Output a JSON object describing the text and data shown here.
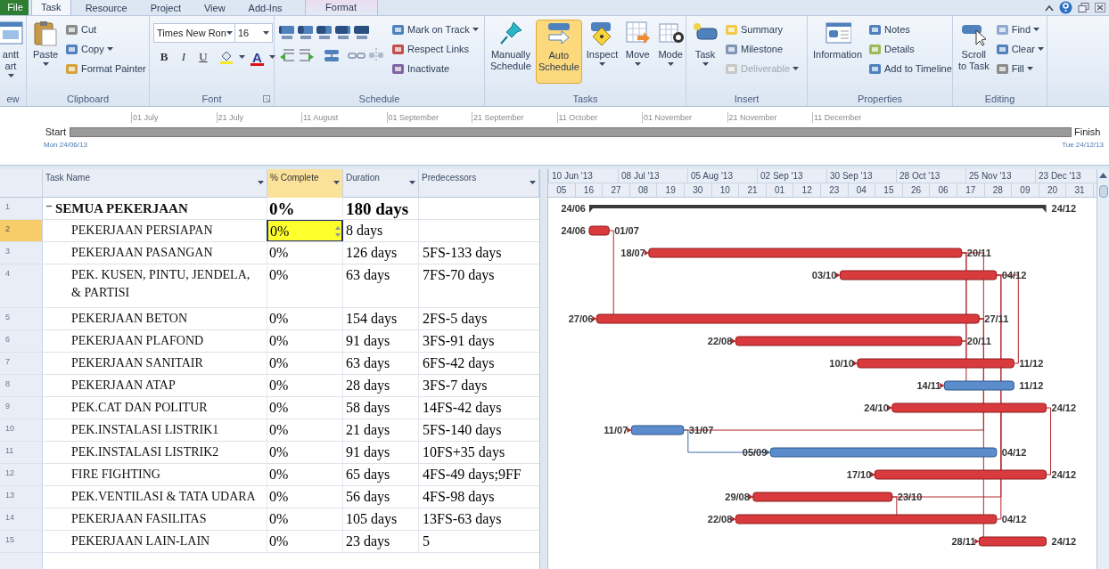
{
  "ribbon": {
    "tabs": [
      {
        "label": "File",
        "kind": "file",
        "selected": false
      },
      {
        "label": "Task",
        "kind": "tab",
        "selected": true
      },
      {
        "label": "Resource",
        "kind": "tab",
        "selected": false
      },
      {
        "label": "Project",
        "kind": "tab",
        "selected": false
      },
      {
        "label": "View",
        "kind": "tab",
        "selected": false
      },
      {
        "label": "Add-Ins",
        "kind": "tab",
        "selected": false
      },
      {
        "label": "Format",
        "kind": "contextual",
        "selected": false
      }
    ],
    "groups": [
      {
        "kind": "standard",
        "label": "ew",
        "items": [
          {
            "kind": "large",
            "lines": [
              "antt",
              "art"
            ],
            "dropdown": true
          }
        ]
      },
      {
        "kind": "standard",
        "label": "Clipboard",
        "items": [
          {
            "kind": "large",
            "lines": [
              "Paste"
            ],
            "dropdown": true
          },
          {
            "kind": "small",
            "label": "Cut"
          },
          {
            "kind": "small",
            "label": "Copy",
            "dropdown": true
          },
          {
            "kind": "small",
            "label": "Format Painter"
          }
        ]
      },
      {
        "kind": "font",
        "label": "Font",
        "font_name": "Times New Ron",
        "font_size": "16",
        "buttons": [
          "B",
          "I",
          "U"
        ],
        "color_button": "A"
      },
      {
        "kind": "schedule",
        "label": "Schedule",
        "items": [
          {
            "kind": "small",
            "label": "Mark on Track",
            "dropdown": true
          },
          {
            "kind": "small",
            "label": "Respect Links"
          },
          {
            "kind": "small",
            "label": "Inactivate"
          }
        ]
      },
      {
        "kind": "standard",
        "label": "Tasks",
        "items": [
          {
            "kind": "large",
            "lines": [
              "Manually",
              "Schedule"
            ],
            "selected": false
          },
          {
            "kind": "large",
            "lines": [
              "Auto",
              "Schedule"
            ],
            "selected": true
          },
          {
            "kind": "large",
            "lines": [
              "Inspect"
            ],
            "dropdown": true
          },
          {
            "kind": "large",
            "lines": [
              "Move"
            ],
            "dropdown": true
          },
          {
            "kind": "large",
            "lines": [
              "Mode"
            ],
            "dropdown": true
          }
        ]
      },
      {
        "kind": "standard",
        "label": "Insert",
        "items": [
          {
            "kind": "large",
            "lines": [
              "Task"
            ],
            "dropdown": true
          },
          {
            "kind": "small",
            "label": "Summary"
          },
          {
            "kind": "small",
            "label": "Milestone"
          },
          {
            "kind": "small",
            "label": "Deliverable",
            "dropdown": true,
            "disabled": true
          }
        ]
      },
      {
        "kind": "standard",
        "label": "Properties",
        "items": [
          {
            "kind": "large",
            "lines": [
              "Information"
            ]
          },
          {
            "kind": "small",
            "label": "Notes"
          },
          {
            "kind": "small",
            "label": "Details"
          },
          {
            "kind": "small",
            "label": "Add to Timeline"
          }
        ]
      },
      {
        "kind": "standard",
        "label": "Editing",
        "items": [
          {
            "kind": "large",
            "lines": [
              "Scroll",
              "to Task"
            ]
          },
          {
            "kind": "small",
            "label": "Find",
            "dropdown": true
          },
          {
            "kind": "small",
            "label": "Clear",
            "dropdown": true
          },
          {
            "kind": "small",
            "label": "Fill",
            "dropdown": true
          }
        ]
      }
    ]
  },
  "timeline": {
    "start_label": "Start",
    "start_date": "Mon 24/06/13",
    "finish_label": "Finish",
    "finish_date": "Tue 24/12/13",
    "ticks": [
      "01 July",
      "21 July",
      "11 August",
      "01 September",
      "21 September",
      "11 October",
      "01 November",
      "21 November",
      "11 December"
    ]
  },
  "table": {
    "columns": [
      {
        "label": "Task Name",
        "selected": false
      },
      {
        "label": "% Complete",
        "selected": true
      },
      {
        "label": "Duration",
        "selected": false
      },
      {
        "label": "Predecessors",
        "selected": false
      }
    ],
    "rows": [
      {
        "id": "1",
        "name": "SEMUA PEKERJAAN",
        "complete": "0%",
        "duration": "180 days",
        "selected": false,
        "expanded": true,
        "start": "24/06",
        "finish": "24/12",
        "children": [
          {
            "id": "2",
            "name": "PEKERJAAN PERSIAPAN",
            "complete": "0%",
            "duration": "8 days",
            "selected": true,
            "critical": true,
            "start": "24/06",
            "finish": "01/07"
          },
          {
            "id": "3",
            "name": "PEKERJAAN PASANGAN",
            "complete": "0%",
            "duration": "126 days",
            "predecessors": "5FS-133 days",
            "selected": false,
            "critical": true,
            "start": "18/07",
            "finish": "20/11"
          },
          {
            "id": "4",
            "name": "PEK. KUSEN, PINTU, JENDELA, & PARTISI",
            "complete": "0%",
            "duration": "63 days",
            "predecessors": "7FS-70 days",
            "selected": false,
            "critical": true,
            "start": "03/10",
            "finish": "04/12"
          },
          {
            "id": "5",
            "name": "PEKERJAAN BETON",
            "complete": "0%",
            "duration": "154 days",
            "predecessors": "2FS-5 days",
            "selected": false,
            "critical": true,
            "start": "27/06",
            "finish": "27/11"
          },
          {
            "id": "6",
            "name": "PEKERJAAN PLAFOND",
            "complete": "0%",
            "duration": "91 days",
            "predecessors": "3FS-91 days",
            "selected": false,
            "critical": true,
            "start": "22/08",
            "finish": "20/11"
          },
          {
            "id": "7",
            "name": "PEKERJAAN SANITAIR",
            "complete": "0%",
            "duration": "63 days",
            "predecessors": "6FS-42 days",
            "selected": false,
            "critical": true,
            "start": "10/10",
            "finish": "11/12"
          },
          {
            "id": "8",
            "name": "PEKERJAAN ATAP",
            "complete": "0%",
            "duration": "28 days",
            "predecessors": "3FS-7 days",
            "selected": false,
            "critical": false,
            "start": "14/11",
            "finish": "11/12"
          },
          {
            "id": "9",
            "name": "PEK.CAT DAN POLITUR",
            "complete": "0%",
            "duration": "58 days",
            "predecessors": "14FS-42 days",
            "selected": false,
            "critical": true,
            "start": "24/10",
            "finish": "24/12"
          },
          {
            "id": "10",
            "name": "PEK.INSTALASI LISTRIK1",
            "complete": "0%",
            "duration": "21 days",
            "predecessors": "5FS-140 days",
            "selected": false,
            "critical": false,
            "start": "11/07",
            "finish": "31/07"
          },
          {
            "id": "11",
            "name": "PEK.INSTALASI LISTRIK2",
            "complete": "0%",
            "duration": "91 days",
            "predecessors": "10FS+35 days",
            "selected": false,
            "critical": false,
            "start": "05/09",
            "finish": "04/12"
          },
          {
            "id": "12",
            "name": "FIRE FIGHTING",
            "complete": "0%",
            "duration": "65 days",
            "predecessors": "4FS-49 days;9FF",
            "selected": false,
            "critical": true,
            "start": "17/10",
            "finish": "24/12"
          },
          {
            "id": "13",
            "name": "PEK.VENTILASI & TATA UDARA",
            "complete": "0%",
            "duration": "56 days",
            "predecessors": "4FS-98 days",
            "selected": false,
            "critical": true,
            "start": "29/08",
            "finish": "23/10"
          },
          {
            "id": "14",
            "name": "PEKERJAAN FASILITAS",
            "complete": "0%",
            "duration": "105 days",
            "predecessors": "13FS-63 days",
            "selected": false,
            "critical": true,
            "start": "22/08",
            "finish": "04/12"
          },
          {
            "id": "15",
            "name": "PEKERJAAN LAIN-LAIN",
            "complete": "0%",
            "duration": "23 days",
            "predecessors": "5",
            "selected": false,
            "critical": true,
            "start": "28/11",
            "finish": "24/12"
          }
        ]
      }
    ]
  },
  "gantt": {
    "months": [
      "10 Jun '13",
      "08 Jul '13",
      "05 Aug '13",
      "02 Sep '13",
      "30 Sep '13",
      "28 Oct '13",
      "25 Nov '13",
      "23 Dec '13"
    ],
    "days": [
      "05",
      "16",
      "27",
      "08",
      "19",
      "30",
      "10",
      "21",
      "01",
      "12",
      "23",
      "04",
      "15",
      "26",
      "06",
      "17",
      "28",
      "09",
      "20",
      "31"
    ]
  }
}
